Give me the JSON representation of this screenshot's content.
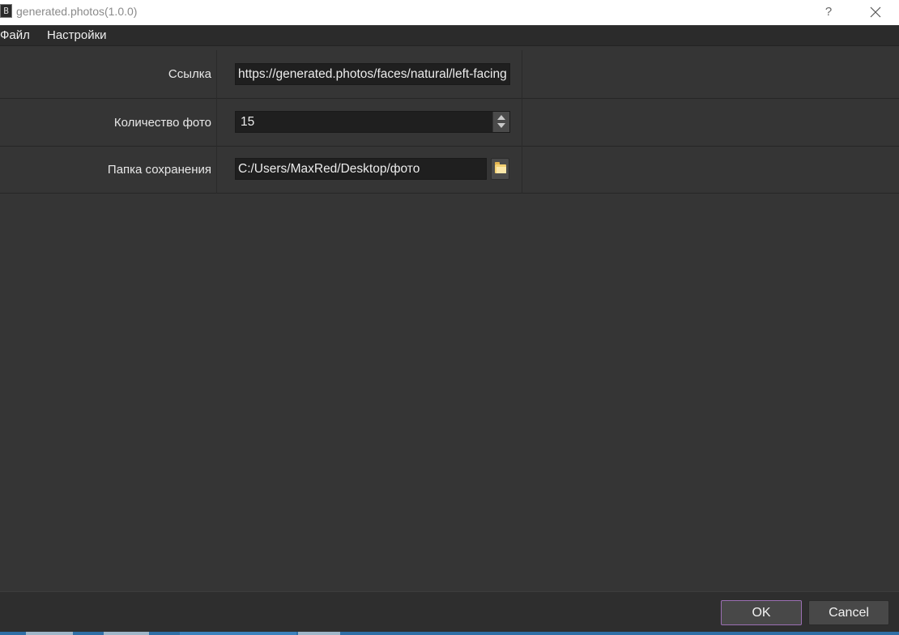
{
  "window": {
    "title": "generated.photos(1.0.0)",
    "icon_glyph": "B",
    "help_label": "?"
  },
  "menu": {
    "file": "Файл",
    "settings": "Настройки"
  },
  "form": {
    "link_label": "Ссылка",
    "link_value": "https://generated.photos/faces/natural/left-facing",
    "count_label": "Количество фото",
    "count_value": "15",
    "folder_label": "Папка сохранения",
    "folder_value": "C:/Users/MaxRed/Desktop/фото"
  },
  "buttons": {
    "ok": "OK",
    "cancel": "Cancel"
  },
  "icons": {
    "app": "app-icon",
    "help": "help-icon",
    "close": "close-icon",
    "spin_up": "spin-up-icon",
    "spin_down": "spin-down-icon",
    "browse": "folder-icon"
  },
  "colors": {
    "background": "#353535",
    "menubar": "#2b2b2b",
    "field": "#1f1f1f",
    "ok_border": "#9b6fb3"
  }
}
